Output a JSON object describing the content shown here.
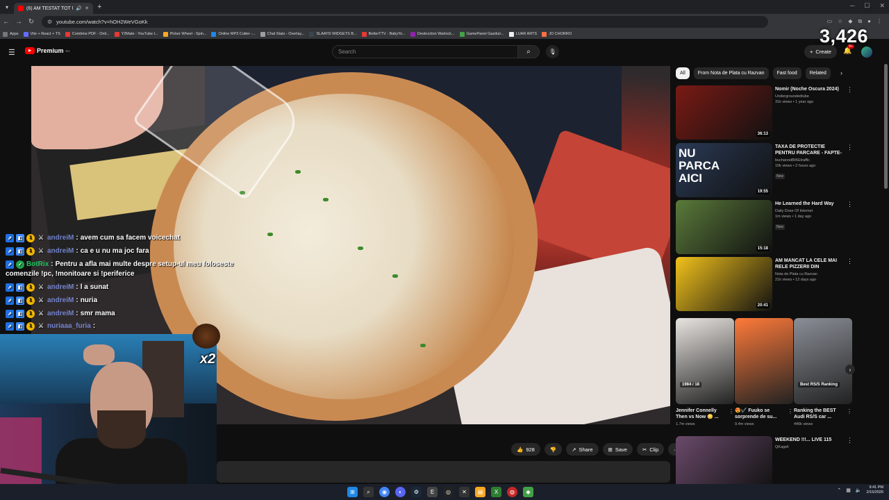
{
  "browser": {
    "tab_title": "(6) AM TESTAT TOT MENIUL...",
    "url": "youtube.com/watch?v=hOH2WeVGoKk",
    "bookmarks": [
      {
        "label": "Apps",
        "color": "#777777"
      },
      {
        "label": "Vite + React + TS",
        "color": "#646cff"
      },
      {
        "label": "Combine PDF - Onli...",
        "color": "#e53935"
      },
      {
        "label": "Y2Mate - YouTube t...",
        "color": "#e53935"
      },
      {
        "label": "Picker Wheel - Spin...",
        "color": "#f9a825"
      },
      {
        "label": "Online MP3 Cutter -...",
        "color": "#1e88e5"
      },
      {
        "label": "Chat Stats - Overlay...",
        "color": "#9e9e9e"
      },
      {
        "label": "SLAAYD WIDGETS B...",
        "color": "#37474f"
      },
      {
        "label": "BetterTTV - BabyYo...",
        "color": "#e53935"
      },
      {
        "label": "Destruction Warlock...",
        "color": "#8e24aa"
      },
      {
        "label": "GamePanel Gazduir...",
        "color": "#43a047"
      },
      {
        "label": "LUAR ARTS",
        "color": "#eeeeee"
      },
      {
        "label": "JO CHORRO",
        "color": "#ff7043"
      }
    ]
  },
  "youtube": {
    "logo_text": "Premium",
    "logo_region": "RO",
    "search_placeholder": "Search",
    "create_label": "Create",
    "notification_count": "9+"
  },
  "overlay": {
    "view_count": "3,426",
    "multiplier": "x2"
  },
  "chat": [
    {
      "user": "andreiM",
      "message": "avem cum sa facem voicechat",
      "kind": "user"
    },
    {
      "user": "andreiM",
      "message": "ca e u nu ma joc fara",
      "kind": "user"
    },
    {
      "user": "BotRix",
      "message": "Pentru a afla mai multe despre setup-ul meu foloseste",
      "message_cont": "comenzile !pc, !monitoare si !periferice",
      "kind": "bot"
    },
    {
      "user": "andreiM",
      "message": "l a sunat",
      "kind": "user"
    },
    {
      "user": "andreiM",
      "message": "nuria",
      "kind": "user"
    },
    {
      "user": "andreiM",
      "message": "smr mama",
      "kind": "user"
    },
    {
      "user": "nuriaaa_furia",
      "message": "",
      "kind": "user"
    }
  ],
  "actions": {
    "like_count": "928",
    "share": "Share",
    "save": "Save",
    "clip": "Clip"
  },
  "chips": [
    "All",
    "From Nota de Plata cu Razvan",
    "Fast food",
    "Related"
  ],
  "recommendations": [
    {
      "title": "Nomir (Noche Oscura 2024)",
      "channel": "Undergroundedtube",
      "meta": "31k views • 1 year ago",
      "duration": "36:13",
      "new": "",
      "thumb_color": "#7a1a14"
    },
    {
      "title": "TAXA DE PROTECTIE PENTRU PARCARE - FAPTE-N TRAFIC ...",
      "channel": "bucharestBIKEtraffic",
      "meta": "10k views • 2 hours ago",
      "duration": "19:55",
      "new": "New",
      "thumb_color": "#2a3a55",
      "thumb_text": "NU PARCA AICI"
    },
    {
      "title": "He Learned the Hard Way",
      "channel": "Daily Dose Of Internet",
      "meta": "1m views • 1 day ago",
      "duration": "15:18",
      "new": "New",
      "thumb_color": "#5a7a3a"
    },
    {
      "title": "AM MANCAT LA CELE MAI RELE PIZZERII DIN BUCURESTI",
      "channel": "Nota de Plata cu Razvan",
      "meta": "21k views • 12 days ago",
      "duration": "20:41",
      "new": "",
      "thumb_color": "#f2c21b"
    },
    {
      "title": "WEEKEND !!!... LIVE 115",
      "channel": "QKageli",
      "meta": "",
      "duration": "",
      "new": "",
      "thumb_color": "#6a4a6a"
    }
  ],
  "shorts": [
    {
      "title": "Jennifer Connelly Then vs Now 😳 ...",
      "views": "1.7m views",
      "thumb_color": "#e8e4e0",
      "badge": "1984 / 18"
    },
    {
      "title": "😍✔️ Fuuko se sorprende de su...",
      "views": "9.4m views",
      "thumb_color": "#ff7a3a",
      "badge": ""
    },
    {
      "title": "Ranking the BEST Audi RS/S car ...",
      "views": "446k views",
      "thumb_color": "#8a8e96",
      "badge": "Best RS/S Ranking"
    }
  ],
  "taskbar": {
    "time": "9:41 PM",
    "date": "2/15/2026"
  }
}
